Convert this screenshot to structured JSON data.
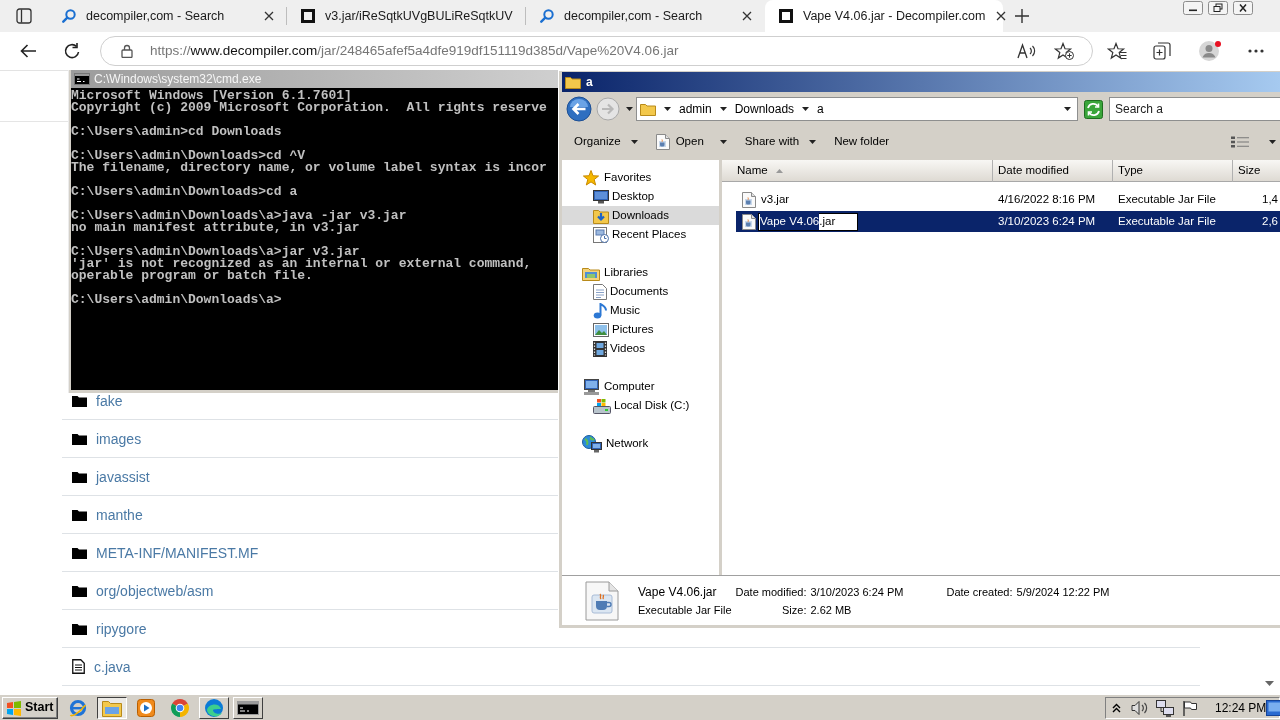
{
  "browser": {
    "tabs": [
      {
        "kind": "search",
        "title": "decompiler,com - Search",
        "closable": true,
        "selected": false
      },
      {
        "kind": "site",
        "title": "v3.jar/iReSqtkUVgBULiReSqtkUV",
        "closable": false,
        "selected": false
      },
      {
        "kind": "search",
        "title": "decompiler,com - Search",
        "closable": true,
        "selected": false
      },
      {
        "kind": "site",
        "title": "Vape V4.06.jar - Decompiler.com",
        "closable": true,
        "selected": true
      }
    ],
    "address": {
      "scheme": "https://",
      "host": "www.decompiler.com",
      "path": "/jar/248465afef5a4dfe919df151119d385d/Vape%20V4.06.jar"
    },
    "entries": [
      {
        "kind": "folder",
        "name": "fake"
      },
      {
        "kind": "folder",
        "name": "images"
      },
      {
        "kind": "folder",
        "name": "javassist"
      },
      {
        "kind": "folder",
        "name": "manthe"
      },
      {
        "kind": "folder",
        "name": "META-INF/MANIFEST.MF"
      },
      {
        "kind": "folder",
        "name": "org/objectweb/asm"
      },
      {
        "kind": "folder",
        "name": "ripygore"
      },
      {
        "kind": "file",
        "name": "c.java"
      }
    ]
  },
  "console": {
    "title": "C:\\Windows\\system32\\cmd.exe",
    "blocks": [
      [
        "Microsoft Windows [Version 6.1.7601]",
        "Copyright (c) 2009 Microsoft Corporation.  All rights reserve"
      ],
      [
        "C:\\Users\\admin>cd Downloads"
      ],
      [
        "C:\\Users\\admin\\Downloads>cd ^V",
        "The filename, directory name, or volume label syntax is incor"
      ],
      [
        "C:\\Users\\admin\\Downloads>cd a"
      ],
      [
        "C:\\Users\\admin\\Downloads\\a>java -jar v3.jar",
        "no main manifest attribute, in v3.jar"
      ],
      [
        "C:\\Users\\admin\\Downloads\\a>jar v3.jar",
        "'jar' is not recognized as an internal or external command,",
        "operable program or batch file."
      ],
      [
        "C:\\Users\\admin\\Downloads\\a>"
      ]
    ]
  },
  "explorer": {
    "title": "a",
    "breadcrumb": [
      "admin",
      "Downloads",
      "a"
    ],
    "search": {
      "placeholder": "Search a"
    },
    "toolbar": [
      {
        "kind": "menu",
        "label": "Organize"
      },
      {
        "kind": "open",
        "label": "Open"
      },
      {
        "kind": "menu",
        "label": "Share with"
      },
      {
        "kind": "plain",
        "label": "New folder"
      }
    ],
    "nav": [
      {
        "kind": "favorites",
        "label": "Favorites",
        "selected": false,
        "children": [
          {
            "kind": "desktop",
            "label": "Desktop",
            "selected": false
          },
          {
            "kind": "downloads",
            "label": "Downloads",
            "selected": true
          },
          {
            "kind": "recent",
            "label": "Recent Places",
            "selected": false
          }
        ]
      },
      {
        "kind": "libraries",
        "label": "Libraries",
        "selected": false,
        "children": [
          {
            "kind": "documents",
            "label": "Documents",
            "selected": false
          },
          {
            "kind": "music",
            "label": "Music",
            "selected": false
          },
          {
            "kind": "pictures",
            "label": "Pictures",
            "selected": false
          },
          {
            "kind": "videos",
            "label": "Videos",
            "selected": false
          }
        ]
      },
      {
        "kind": "computer",
        "label": "Computer",
        "selected": false,
        "children": [
          {
            "kind": "disk",
            "label": "Local Disk (C:)",
            "selected": false
          }
        ]
      },
      {
        "kind": "network",
        "label": "Network",
        "selected": false
      }
    ],
    "columns": [
      {
        "label": "Name",
        "sorted": true
      },
      {
        "label": "Date modified",
        "sorted": false
      },
      {
        "label": "Type",
        "sorted": false
      },
      {
        "label": "Size",
        "sorted": false
      }
    ],
    "files": [
      {
        "stem": "v3",
        "ext": ".jar",
        "date": "4/16/2022 8:16 PM",
        "type": "Executable Jar File",
        "size": "1,4",
        "selected": false,
        "editing": false
      },
      {
        "stem": "Vape V4.06",
        "ext": ".jar",
        "date": "3/10/2023 6:24 PM",
        "type": "Executable Jar File",
        "size": "2,6",
        "selected": true,
        "editing": true
      }
    ],
    "details": {
      "name": "Vape V4.06.jar",
      "type": "Executable Jar File",
      "fields": [
        {
          "label": "Date modified:",
          "value": "3/10/2023 6:24 PM"
        },
        {
          "label": "Size:",
          "value": "2.62 MB"
        },
        {
          "label": "Date created:",
          "value": "5/9/2024 12:22 PM"
        }
      ]
    }
  },
  "taskbar": {
    "start": "Start",
    "apps": [
      {
        "kind": "ie",
        "running": false,
        "selected": false
      },
      {
        "kind": "folder",
        "running": true,
        "selected": true
      },
      {
        "kind": "media",
        "running": false,
        "selected": false
      },
      {
        "kind": "chrome",
        "running": false,
        "selected": false
      },
      {
        "kind": "edge",
        "running": true,
        "selected": false
      },
      {
        "kind": "console",
        "running": true,
        "selected": false
      }
    ],
    "clock": "12:24 PM"
  }
}
